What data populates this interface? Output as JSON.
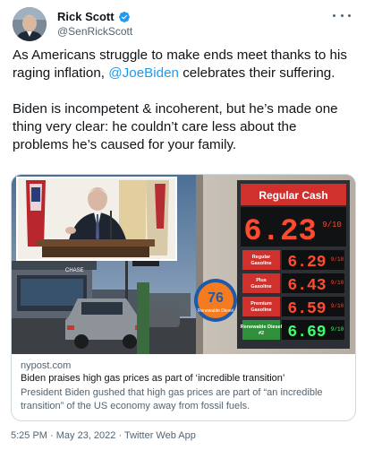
{
  "author": {
    "name": "Rick Scott",
    "handle": "@SenRickScott",
    "verified": true
  },
  "tweet": {
    "paragraph1": {
      "before_mention": "As Americans struggle to make ends meet thanks to his raging inflation, ",
      "mention": "@JoeBiden",
      "after_mention": " celebrates their suffering."
    },
    "paragraph2": "Biden is incompetent & incoherent, but he’s made one thing very clear: he couldn’t care less about the problems he’s caused for your family."
  },
  "link_card": {
    "domain": "nypost.com",
    "title": "Biden praises high gas prices as part of ‘incredible transition’",
    "description": "President Biden gushed that high gas prices are part of “an incredible transition” of the US economy away from fossil fuels.",
    "image": {
      "sign_header": "Regular Cash",
      "sign_price": "6.23",
      "sign_price_fraction": "9/10",
      "rows": [
        {
          "label": "Regular Gasoline",
          "price": "6.29",
          "fraction": "9/10"
        },
        {
          "label": "Plus Gasoline",
          "price": "6.43",
          "fraction": "9/10"
        },
        {
          "label": "Premium Gasoline",
          "price": "6.59",
          "fraction": "9/10"
        },
        {
          "label": "Renewable Diesel #2",
          "price": "6.69",
          "fraction": "9/10"
        }
      ],
      "station_logo": "76",
      "station_logo_sub": "Renewable Diesel",
      "bank_sign": "CHASE"
    },
    "colors": {
      "sign_red": "#d0312d",
      "price_red": "#ff4a2e",
      "price_green": "#38ff6a",
      "logo_blue": "#1e5aa8",
      "logo_orange": "#f47b20"
    }
  },
  "meta": {
    "timestamp": "5:25 PM · May 23, 2022 · Twitter Web App"
  }
}
